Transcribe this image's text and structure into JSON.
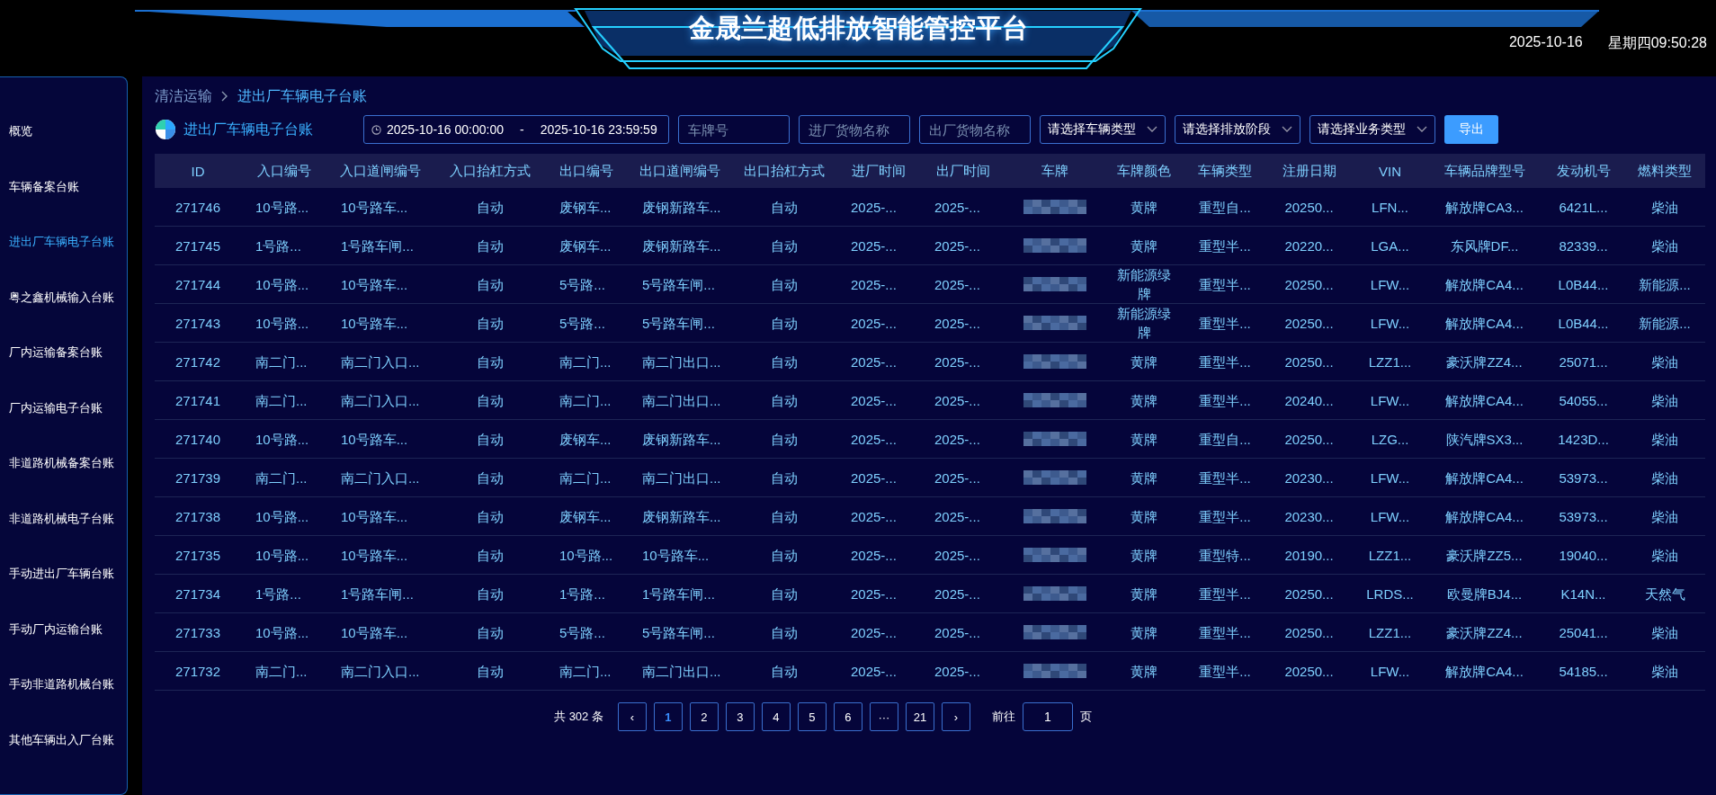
{
  "header": {
    "title": "金晟兰超低排放智能管控平台",
    "date": "2025-10-16",
    "weekday_time": "星期四09:50:28"
  },
  "sidebar": {
    "items": [
      {
        "label": "概览",
        "selected": false
      },
      {
        "label": "车辆备案台账",
        "selected": false
      },
      {
        "label": "进出厂车辆电子台账",
        "selected": true
      },
      {
        "label": "粤之鑫机械输入台账",
        "selected": false
      },
      {
        "label": "厂内运输备案台账",
        "selected": false
      },
      {
        "label": "厂内运输电子台账",
        "selected": false
      },
      {
        "label": "非道路机械备案台账",
        "selected": false
      },
      {
        "label": "非道路机械电子台账",
        "selected": false
      },
      {
        "label": "手动进出厂车辆台账",
        "selected": false
      },
      {
        "label": "手动厂内运输台账",
        "selected": false
      },
      {
        "label": "手动非道路机械台账",
        "selected": false
      },
      {
        "label": "其他车辆出入厂台账",
        "selected": false
      }
    ]
  },
  "breadcrumb": [
    "清洁运输",
    "进出厂车辆电子台账"
  ],
  "page_title": "进出厂车辆电子台账",
  "filters": {
    "date_start": "2025-10-16 00:00:00",
    "date_separator": "-",
    "date_end": "2025-10-16 23:59:59",
    "inputs": [
      {
        "placeholder": "车牌号"
      },
      {
        "placeholder": "进厂货物名称"
      },
      {
        "placeholder": "出厂货物名称"
      }
    ],
    "selects": [
      {
        "value": "请选择车辆类型"
      },
      {
        "value": "请选择排放阶段"
      },
      {
        "value": "请选择业务类型"
      }
    ],
    "export_button": "导出"
  },
  "table": {
    "columns": [
      {
        "label": "ID",
        "kind": "text"
      },
      {
        "label": "入口编号",
        "kind": "text"
      },
      {
        "label": "入口道闸编号",
        "kind": "text"
      },
      {
        "label": "入口抬杠方式",
        "kind": "text"
      },
      {
        "label": "出口编号",
        "kind": "text"
      },
      {
        "label": "出口道闸编号",
        "kind": "text"
      },
      {
        "label": "出口抬杠方式",
        "kind": "text"
      },
      {
        "label": "进厂时间",
        "kind": "text"
      },
      {
        "label": "出厂时间",
        "kind": "text"
      },
      {
        "label": "车牌",
        "kind": "masked"
      },
      {
        "label": "车牌颜色",
        "kind": "text"
      },
      {
        "label": "车辆类型",
        "kind": "text"
      },
      {
        "label": "注册日期",
        "kind": "text"
      },
      {
        "label": "VIN",
        "kind": "text"
      },
      {
        "label": "车辆品牌型号",
        "kind": "text"
      },
      {
        "label": "发动机号",
        "kind": "text"
      },
      {
        "label": "燃料类型",
        "kind": "text"
      }
    ],
    "rows": [
      [
        "271746",
        "10号路...",
        "10号路车...",
        "自动",
        "废钢车...",
        "废钢新路车...",
        "自动",
        "2025-...",
        "2025-...",
        "",
        "黄牌",
        "重型自...",
        "20250...",
        "LFN...",
        "解放牌CA3...",
        "6421L...",
        "柴油"
      ],
      [
        "271745",
        "1号路...",
        "1号路车闸...",
        "自动",
        "废钢车...",
        "废钢新路车...",
        "自动",
        "2025-...",
        "2025-...",
        "",
        "黄牌",
        "重型半...",
        "20220...",
        "LGA...",
        "东风牌DF...",
        "82339...",
        "柴油"
      ],
      [
        "271744",
        "10号路...",
        "10号路车...",
        "自动",
        "5号路...",
        "5号路车闸...",
        "自动",
        "2025-...",
        "2025-...",
        "",
        "新能源绿牌",
        "重型半...",
        "20250...",
        "LFW...",
        "解放牌CA4...",
        "L0B44...",
        "新能源..."
      ],
      [
        "271743",
        "10号路...",
        "10号路车...",
        "自动",
        "5号路...",
        "5号路车闸...",
        "自动",
        "2025-...",
        "2025-...",
        "",
        "新能源绿牌",
        "重型半...",
        "20250...",
        "LFW...",
        "解放牌CA4...",
        "L0B44...",
        "新能源..."
      ],
      [
        "271742",
        "南二门...",
        "南二门入口...",
        "自动",
        "南二门...",
        "南二门出口...",
        "自动",
        "2025-...",
        "2025-...",
        "",
        "黄牌",
        "重型半...",
        "20250...",
        "LZZ1...",
        "豪沃牌ZZ4...",
        "25071...",
        "柴油"
      ],
      [
        "271741",
        "南二门...",
        "南二门入口...",
        "自动",
        "南二门...",
        "南二门出口...",
        "自动",
        "2025-...",
        "2025-...",
        "",
        "黄牌",
        "重型半...",
        "20240...",
        "LFW...",
        "解放牌CA4...",
        "54055...",
        "柴油"
      ],
      [
        "271740",
        "10号路...",
        "10号路车...",
        "自动",
        "废钢车...",
        "废钢新路车...",
        "自动",
        "2025-...",
        "2025-...",
        "",
        "黄牌",
        "重型自...",
        "20250...",
        "LZG...",
        "陕汽牌SX3...",
        "1423D...",
        "柴油"
      ],
      [
        "271739",
        "南二门...",
        "南二门入口...",
        "自动",
        "南二门...",
        "南二门出口...",
        "自动",
        "2025-...",
        "2025-...",
        "",
        "黄牌",
        "重型半...",
        "20230...",
        "LFW...",
        "解放牌CA4...",
        "53973...",
        "柴油"
      ],
      [
        "271738",
        "10号路...",
        "10号路车...",
        "自动",
        "废钢车...",
        "废钢新路车...",
        "自动",
        "2025-...",
        "2025-...",
        "",
        "黄牌",
        "重型半...",
        "20230...",
        "LFW...",
        "解放牌CA4...",
        "53973...",
        "柴油"
      ],
      [
        "271735",
        "10号路...",
        "10号路车...",
        "自动",
        "10号路...",
        "10号路车...",
        "自动",
        "2025-...",
        "2025-...",
        "",
        "黄牌",
        "重型特...",
        "20190...",
        "LZZ1...",
        "豪沃牌ZZ5...",
        "19040...",
        "柴油"
      ],
      [
        "271734",
        "1号路...",
        "1号路车闸...",
        "自动",
        "1号路...",
        "1号路车闸...",
        "自动",
        "2025-...",
        "2025-...",
        "",
        "黄牌",
        "重型半...",
        "20250...",
        "LRDS...",
        "欧曼牌BJ4...",
        "K14N...",
        "天然气"
      ],
      [
        "271733",
        "10号路...",
        "10号路车...",
        "自动",
        "5号路...",
        "5号路车闸...",
        "自动",
        "2025-...",
        "2025-...",
        "",
        "黄牌",
        "重型半...",
        "20250...",
        "LZZ1...",
        "豪沃牌ZZ4...",
        "25041...",
        "柴油"
      ],
      [
        "271732",
        "南二门...",
        "南二门入口...",
        "自动",
        "南二门...",
        "南二门出口...",
        "自动",
        "2025-...",
        "2025-...",
        "",
        "黄牌",
        "重型半...",
        "20250...",
        "LFW...",
        "解放牌CA4...",
        "54185...",
        "柴油"
      ]
    ]
  },
  "pagination": {
    "total": "共 302 条",
    "prev": "‹",
    "next": "›",
    "pages": [
      {
        "label": "1",
        "selected": true
      },
      {
        "label": "2",
        "selected": false
      },
      {
        "label": "3",
        "selected": false
      },
      {
        "label": "4",
        "selected": false
      },
      {
        "label": "5",
        "selected": false
      },
      {
        "label": "6",
        "selected": false
      },
      {
        "label": "···",
        "selected": false
      },
      {
        "label": "21",
        "selected": false
      }
    ],
    "goto_label": "前往",
    "goto_value": "1",
    "goto_unit": "页"
  }
}
